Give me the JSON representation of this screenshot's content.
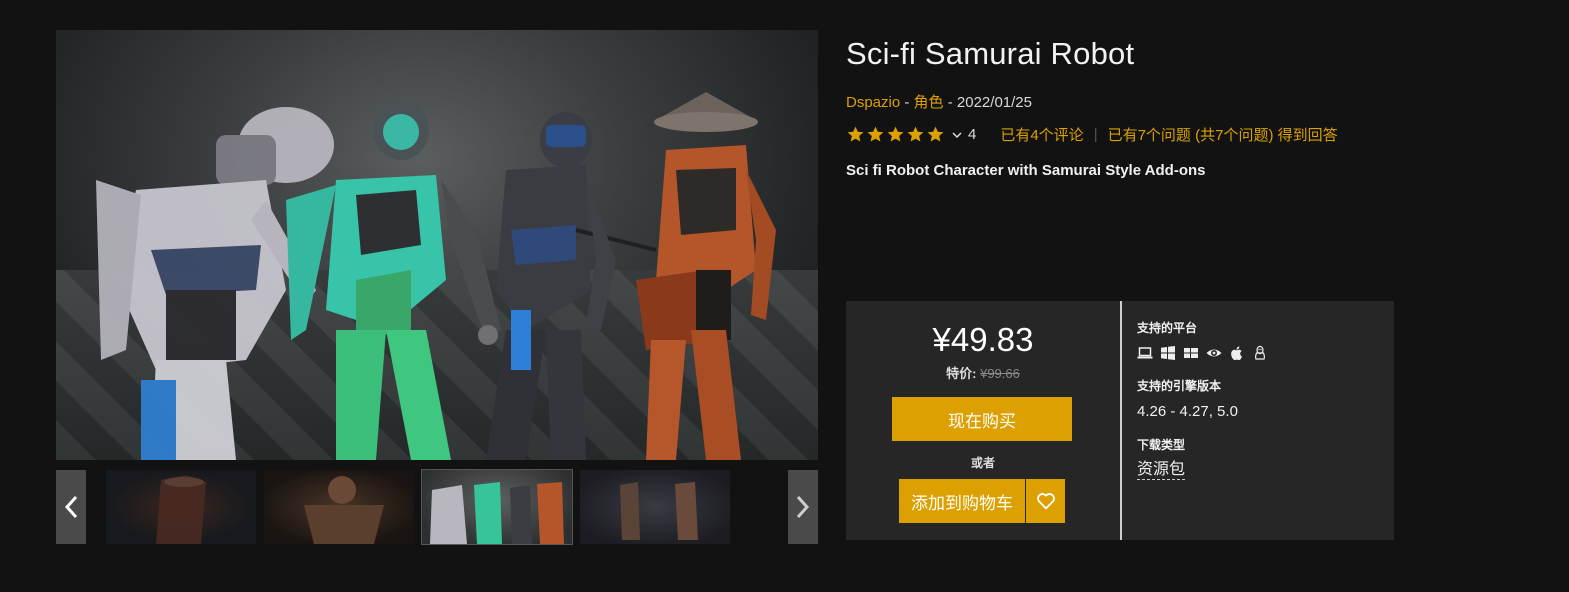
{
  "product": {
    "title": "Sci-fi Samurai Robot",
    "author": "Dspazio",
    "meta_sep1": " - ",
    "category": "角色",
    "meta_sep2": " - ",
    "date": "2022/01/25",
    "rating_count": "4",
    "reviews_text": "已有4个评论",
    "questions_text": "已有7个问题 (共7个问题) 得到回答",
    "short_description": "Sci fi Robot Character with Samurai Style Add-ons",
    "stars": 5
  },
  "purchase": {
    "price": "¥49.83",
    "sale_label": "特价:",
    "original_price": "¥99.66",
    "buy_now_label": "现在购买",
    "or_label": "或者",
    "add_to_cart_label": "添加到购物车"
  },
  "specs": {
    "platforms_label": "支持的平台",
    "platform_icons": [
      "laptop-icon",
      "windows-icon",
      "windows-store-icon",
      "eye-vr-icon",
      "apple-icon",
      "linux-icon"
    ],
    "engine_label": "支持的引擎版本",
    "engine_value": "4.26 - 4.27, 5.0",
    "download_label": "下载类型",
    "download_value": "资源包"
  },
  "colors": {
    "accent": "#dca100",
    "background": "#121212",
    "panel": "#262626"
  },
  "gallery": {
    "thumbnail_count": 4,
    "selected_index": 3
  }
}
